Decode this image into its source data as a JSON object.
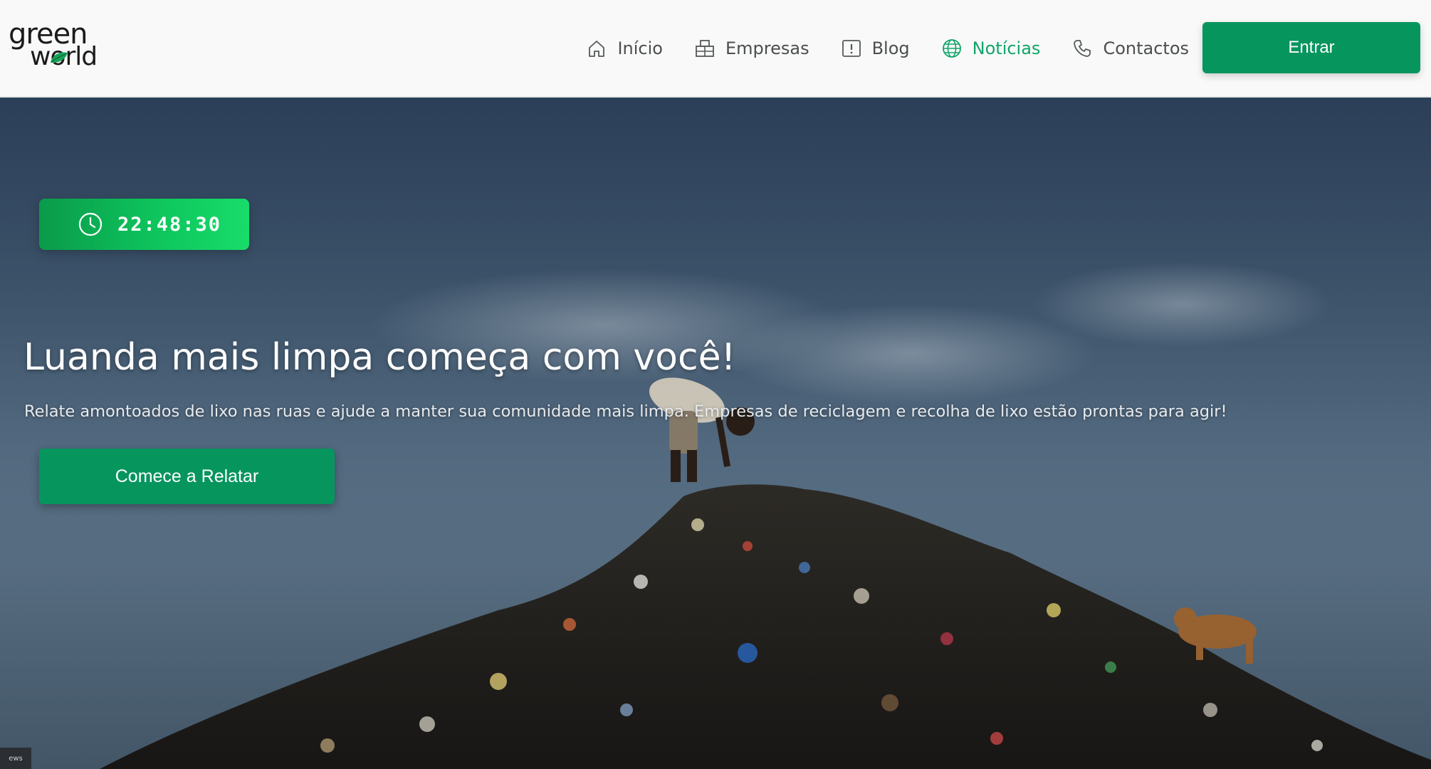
{
  "brand": {
    "logo_top": "green",
    "logo_bottom": "world"
  },
  "nav": {
    "items": [
      {
        "label": "Início",
        "icon": "home-icon"
      },
      {
        "label": "Empresas",
        "icon": "building-icon"
      },
      {
        "label": "Blog",
        "icon": "info-square-icon"
      },
      {
        "label": "Notícias",
        "icon": "globe-icon",
        "active": true
      },
      {
        "label": "Contactos",
        "icon": "phone-icon"
      }
    ],
    "login_label": "Entrar"
  },
  "hero": {
    "clock": "22:48:30",
    "title": "Luanda mais limpa começa com você!",
    "subtitle": "Relate amontoados de lixo nas ruas e ajude a manter sua comunidade mais limpa. Empresas de reciclagem e recolha de lixo estão prontas para agir!",
    "cta_label": "Comece a Relatar",
    "corner_tag": "ews"
  },
  "colors": {
    "accent": "#07955e",
    "active_link": "#13a46a",
    "clock_green": "#0ec85e"
  }
}
